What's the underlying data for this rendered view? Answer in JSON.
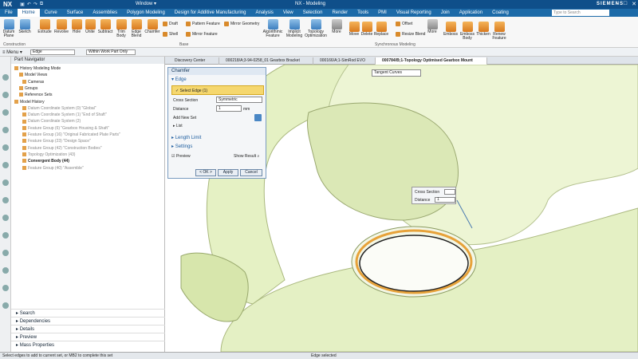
{
  "titlebar": {
    "logo": "NX",
    "window_menu": "Window ▾",
    "title": "NX - Modeling",
    "brand": "SIEMENS"
  },
  "menubar": {
    "tabs": [
      "File",
      "Home",
      "Curve",
      "Surface",
      "Assemblies",
      "Polygon Modeling",
      "Design for Additive Manufacturing",
      "Analysis",
      "View",
      "Selection",
      "Render",
      "Tools",
      "PMI",
      "Visual Reporting",
      "Join",
      "Application",
      "Coating"
    ],
    "active": "Home",
    "search_placeholder": "Type to Search"
  },
  "ribbon": {
    "datum": "Datum Plane",
    "sketch": "Sketch",
    "extrude": "Extrude",
    "revolve": "Revolve",
    "hole": "Hole",
    "unite": "Unite",
    "subtract": "Subtract",
    "trim": "Trim Body",
    "edgeblend": "Edge Blend",
    "chamfer": "Chamfer",
    "draft": "Draft",
    "shell": "Shell",
    "pattern": "Pattern Feature",
    "mirrorfeat": "Mirror Feature",
    "mirrorgeom": "Mirror Geometry",
    "algorithmic": "Algorithmic Feature",
    "implicit": "Implicit Modeling",
    "topology": "Topology Optimization",
    "more": "More",
    "move": "Move",
    "delete": "Delete",
    "replace": "Replace",
    "offset": "Offset",
    "resizeblend": "Resize Blend",
    "more2": "More",
    "emboss": "Emboss",
    "embossbody": "Emboss Body",
    "thicken": "Thicken",
    "renew": "Renew Feature",
    "grp_construction": "Construction",
    "grp_base": "Base",
    "grp_sync": "Synchronous Modeling"
  },
  "toolbar2": {
    "menu": "≡ Menu ▾",
    "filter": "Edge",
    "scope": "Within Work Part Only"
  },
  "navigator": {
    "title": "Part Navigator",
    "rows": [
      {
        "t": "History Modeling Mode",
        "s": "normal"
      },
      {
        "t": "Model Views",
        "s": "normal"
      },
      {
        "t": "Cameras",
        "s": "normal"
      },
      {
        "t": "Groups",
        "s": "normal"
      },
      {
        "t": "Reference Sets",
        "s": "normal"
      },
      {
        "t": "Model History",
        "s": "normal"
      },
      {
        "t": "Datum Coordinate System (0) \"Global\"",
        "s": "grey"
      },
      {
        "t": "Datum Coordinate System (1) \"End of Shaft\"",
        "s": "grey"
      },
      {
        "t": "Datum Coordinate System (2)",
        "s": "grey"
      },
      {
        "t": "Feature Group (6) \"Gearbox Housing & Shaft\"",
        "s": "grey"
      },
      {
        "t": "Feature Group (16) \"Original Fabricated Plate Parts\"",
        "s": "grey"
      },
      {
        "t": "Feature Group (23) \"Design Space\"",
        "s": "grey"
      },
      {
        "t": "Feature Group (42) \"Construction Bodies\"",
        "s": "grey"
      },
      {
        "t": "Topology Optimization (43)",
        "s": "grey"
      },
      {
        "t": "Convergent Body (44)",
        "s": "bold"
      },
      {
        "t": "Feature Group (40) \"Assemble\"",
        "s": "grey"
      }
    ],
    "sections": [
      "Search",
      "Dependencies",
      "Details",
      "Preview",
      "Mass Properties"
    ]
  },
  "doc_tabs": [
    "Discovery Center",
    "000218/A;3-94-0258_01 Gearbox Bracket",
    "000166/A;1-SimRod EVO",
    "000784/B;1-Topology Optimised Gearbox Mount"
  ],
  "dialog": {
    "title": "Chamfer",
    "edge_sec": "Edge",
    "select_edge": "Select Edge (1)",
    "cross_label": "Cross Section",
    "cross_value": "Symmetric",
    "distance_label": "Distance",
    "distance_value": "1",
    "unit": "mm",
    "add_new_set": "Add New Set",
    "list": "List",
    "length_limit": "Length Limit",
    "settings": "Settings",
    "preview": "Preview",
    "show_result": "Show Result",
    "ok": "< OK >",
    "apply": "Apply",
    "cancel": "Cancel"
  },
  "viewport": {
    "tangent": "Tangent Curves",
    "mini_cross": "Cross Section",
    "mini_distance": "Distance",
    "mini_value": "1"
  },
  "status": {
    "left": "Select edges to add to current set, or MB2 to complete this set",
    "center": "Edge selected"
  }
}
